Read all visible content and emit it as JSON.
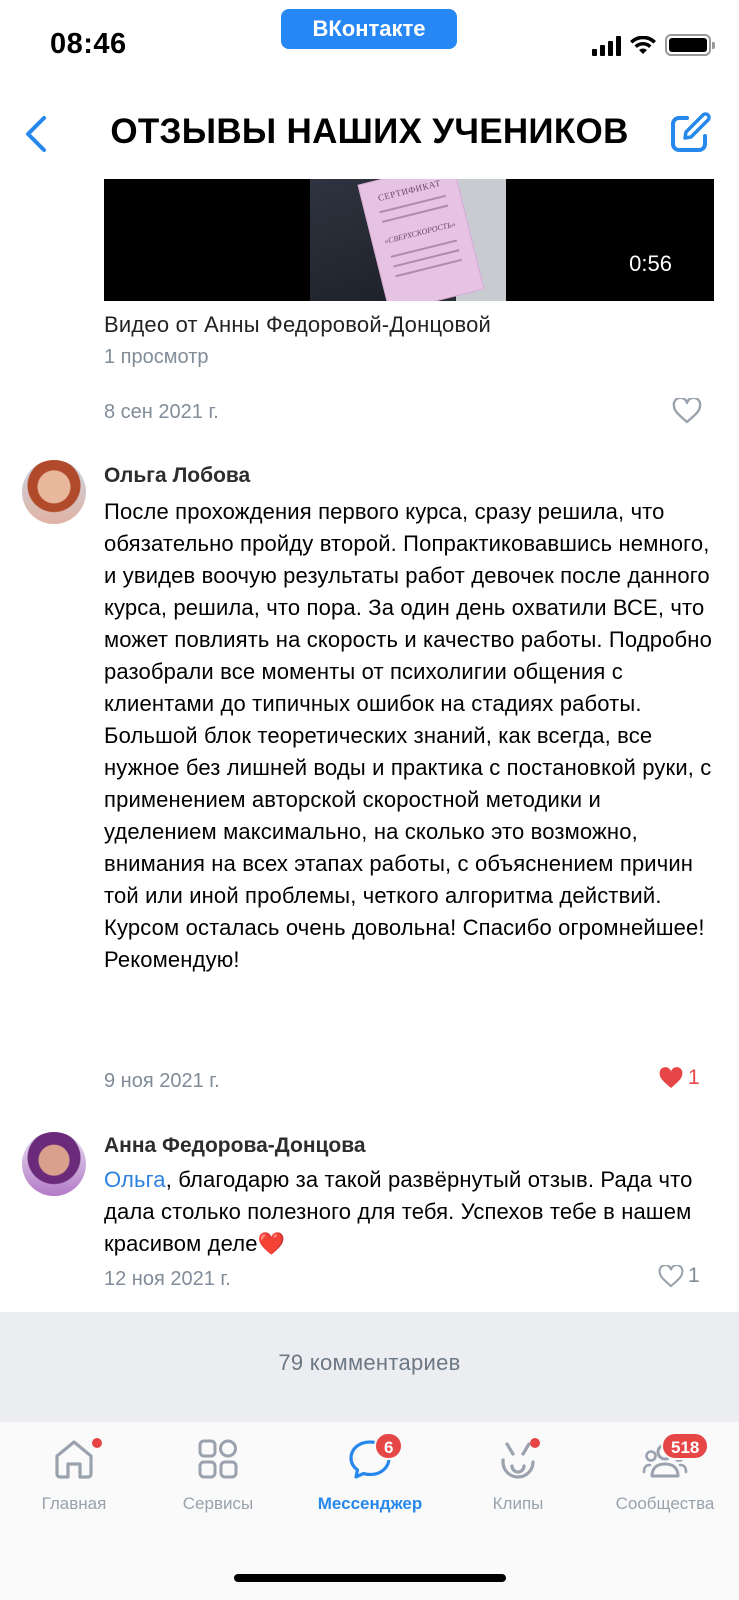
{
  "status_bar": {
    "time": "08:46",
    "app_pill": "ВКонтакте"
  },
  "nav": {
    "title": "ОТЗЫВЫ НАШИХ УЧЕНИКОВ"
  },
  "video": {
    "duration": "0:56",
    "title": "Видео от Анны Федоровой-Донцовой",
    "views": "1 просмотр",
    "date": "8 сен 2021 г.",
    "certificate_title": "СЕРТИФИКАТ",
    "certificate_subtitle": "«СВЕРХСКОРОСТЬ»"
  },
  "comments": [
    {
      "author": "Ольга Лобова",
      "text": "После прохождения первого курса, сразу решила, что обязательно пройду второй. Попрактиковавшись немного, и увидев воочую результаты работ девочек после данного курса, решила, что пора. За один день охватили ВСЕ, что может повлиять на скорость и качество работы. Подробно разобрали все моменты от психолигии общения с клиентами до типичных ошибок на стадиях работы. Большой блок теоретических знаний, как всегда, все нужное без лишней воды и практика с постановкой руки, с применением авторской скоростной методики и уделением максимально, на сколько это возможно, внимания на всех этапах работы, с объяснением причин той или иной проблемы, четкого алгоритма действий. Курсом осталась очень довольна! Спасибо огромнейшее! Рекомендую!",
      "date": "9 ноя 2021 г.",
      "likes": "1",
      "liked": true
    },
    {
      "author": "Анна Федорова-Донцова",
      "mention": "Ольга",
      "text": ", благодарю за такой развёрнутый отзыв. Рада что дала столько полезного для тебя. Успехов тебе в нашем красивом деле❤️",
      "date": "12 ноя 2021 г.",
      "likes": "1",
      "liked": false
    }
  ],
  "comments_count": "79 комментариев",
  "tabs": [
    {
      "label": "Главная",
      "icon": "home-icon",
      "dot": true
    },
    {
      "label": "Сервисы",
      "icon": "services-icon",
      "dot": false
    },
    {
      "label": "Мессенджер",
      "icon": "messenger-icon",
      "badge": "6",
      "active": true
    },
    {
      "label": "Клипы",
      "icon": "clips-icon",
      "dot": true
    },
    {
      "label": "Сообщества",
      "icon": "communities-icon",
      "badge": "518"
    }
  ],
  "colors": {
    "accent": "#2688eb",
    "badge": "#e64646",
    "secondary_text": "#818c99",
    "footer_bg": "#ebedf0"
  }
}
